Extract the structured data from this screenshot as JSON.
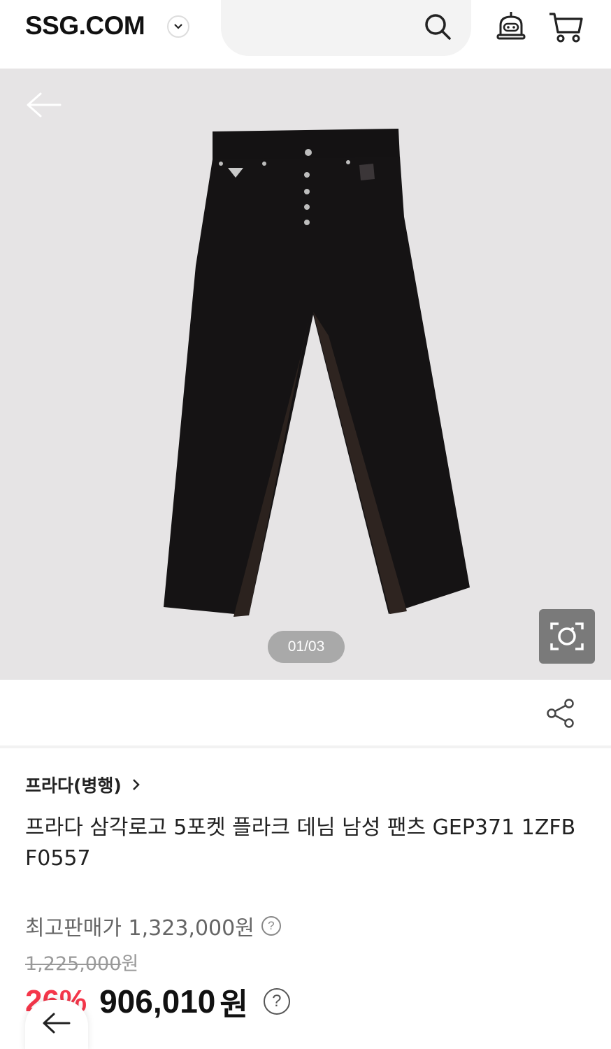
{
  "header": {
    "logo": "SSG.COM",
    "logo_menu_icon": "chevron-down-icon",
    "search_icon": "search-icon",
    "notification_icon": "bell-icon",
    "cart_icon": "cart-icon"
  },
  "gallery": {
    "back_icon": "arrow-left-icon",
    "page_indicator": "01/03",
    "lens_icon": "camera-lens-icon",
    "background_color": "#e6e4e5"
  },
  "share_icon": "share-icon",
  "product": {
    "brand": "프라다(병행)",
    "title": "프라다 삼각로고 5포켓 플라크 데님 남성 팬츠 GEP371 1ZFB F0557",
    "max_price_label": "최고판매가 1,323,000원",
    "original_price_value": "1,225,000",
    "original_price_unit": "원",
    "discount": "26%",
    "price": "906,010",
    "price_unit": "원",
    "help_glyph": "?"
  },
  "colors": {
    "discount": "#f5364a",
    "text": "#222222"
  }
}
